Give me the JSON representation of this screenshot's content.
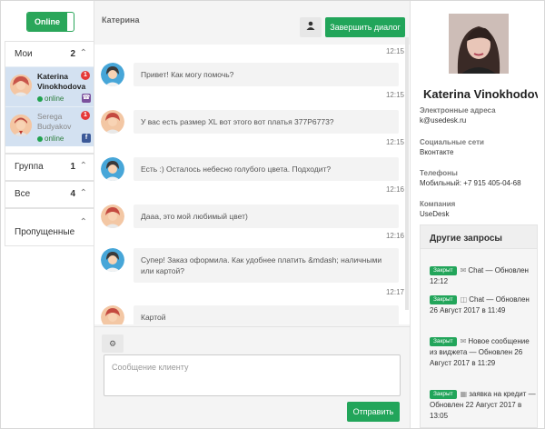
{
  "status_toggle": {
    "label": "Online"
  },
  "groups": {
    "mine": {
      "title": "Мои",
      "count": "2"
    },
    "group": {
      "title": "Группа",
      "count": "1"
    },
    "all": {
      "title": "Все",
      "count": "4"
    },
    "missed": {
      "title": "Пропущенные"
    }
  },
  "contacts": [
    {
      "name": "Katerina Vinokhodova",
      "status": "online",
      "badge": "1",
      "network": "viber",
      "network_color": "#7b519d"
    },
    {
      "name": "Serega Budyakov",
      "status": "online",
      "badge": "1",
      "network": "facebook",
      "network_color": "#3b5998"
    }
  ],
  "chat": {
    "header_name": "Катерина",
    "end_button": "Завершить диалог",
    "messages": [
      {
        "time": "12:15",
        "text": "Привет! Как могу помочь?",
        "sender": "agent"
      },
      {
        "time": "12:15",
        "text": "У вас есть размер XL вот этого вот платья 377P6773?",
        "sender": "client"
      },
      {
        "time": "12:16",
        "text": "Есть :) Осталось небесно голубого цвета. Подходит?",
        "sender": "agent"
      },
      {
        "time": "12:16",
        "text": "Дааа, это мой любимый цвет)",
        "sender": "client"
      },
      {
        "time": "12:17",
        "text": "Супер! Заказ оформила. Как удобнее платить &mdash; наличными или картой?",
        "sender": "agent"
      },
      {
        "time": "12:17",
        "text": "Картой",
        "sender": "client"
      }
    ],
    "top_time": "12:15",
    "reply_placeholder": "Сообщение клиенту",
    "send_button": "Отправить"
  },
  "profile": {
    "name": "Katerina Vinokhodova",
    "email_label": "Электронные адреса",
    "email": "k@usedesk.ru",
    "social_label": "Социальные сети",
    "social": "Вконтакте",
    "phone_label": "Телефоны",
    "phone": "Мобильный: +7 915 405-04-68",
    "company_label": "Компания",
    "company": "UseDesk"
  },
  "other_requests": {
    "title": "Другие запросы",
    "items": [
      {
        "tag": "Закрыт",
        "text": "Chat — Обновлен 12:12"
      },
      {
        "tag": "Закрыт",
        "text": "Chat — Обновлен 26 Август 2017 в 11:49"
      },
      {
        "tag": "Закрыт",
        "text": "Новое сообщение из виджета — Обновлен 26 Август 2017 в 11:29"
      },
      {
        "tag": "Закрыт",
        "text": "заявка на кредит — Обновлен 22 Август 2017 в 13:05"
      }
    ]
  }
}
